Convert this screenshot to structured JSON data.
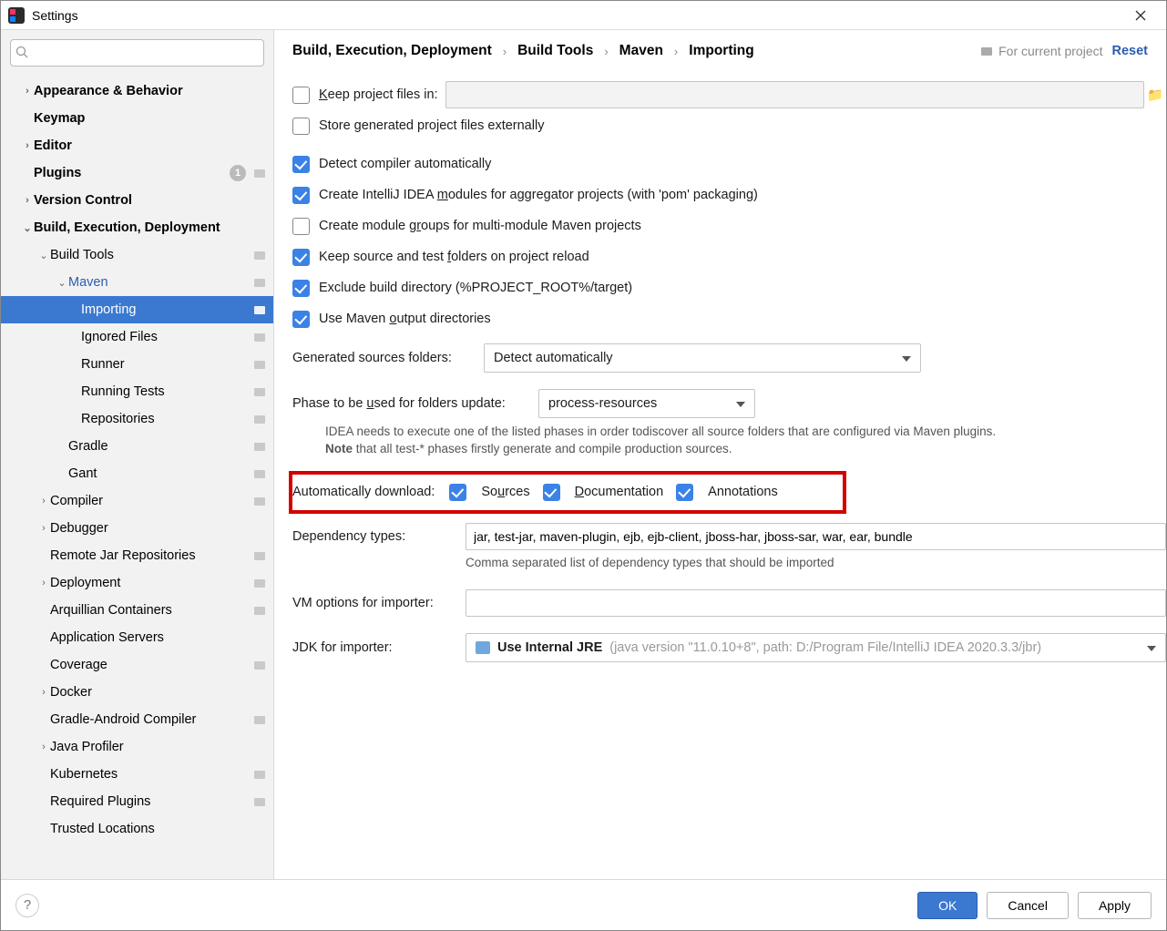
{
  "window": {
    "title": "Settings"
  },
  "search": {
    "placeholder": ""
  },
  "sidebar": {
    "items": [
      {
        "label": "Appearance & Behavior"
      },
      {
        "label": "Keymap"
      },
      {
        "label": "Editor"
      },
      {
        "label": "Plugins",
        "badge": "1"
      },
      {
        "label": "Version Control"
      },
      {
        "label": "Build, Execution, Deployment"
      },
      {
        "label": "Build Tools"
      },
      {
        "label": "Maven"
      },
      {
        "label": "Importing"
      },
      {
        "label": "Ignored Files"
      },
      {
        "label": "Runner"
      },
      {
        "label": "Running Tests"
      },
      {
        "label": "Repositories"
      },
      {
        "label": "Gradle"
      },
      {
        "label": "Gant"
      },
      {
        "label": "Compiler"
      },
      {
        "label": "Debugger"
      },
      {
        "label": "Remote Jar Repositories"
      },
      {
        "label": "Deployment"
      },
      {
        "label": "Arquillian Containers"
      },
      {
        "label": "Application Servers"
      },
      {
        "label": "Coverage"
      },
      {
        "label": "Docker"
      },
      {
        "label": "Gradle-Android Compiler"
      },
      {
        "label": "Java Profiler"
      },
      {
        "label": "Kubernetes"
      },
      {
        "label": "Required Plugins"
      },
      {
        "label": "Trusted Locations"
      }
    ]
  },
  "breadcrumbs": {
    "a": "Build, Execution, Deployment",
    "b": "Build Tools",
    "c": "Maven",
    "d": "Importing"
  },
  "header": {
    "for_project": "For current project",
    "reset": "Reset"
  },
  "form": {
    "keep_project_files_label": "eep project files in:",
    "keep_project_files_prefix": "K",
    "store_external": "Store generated project files externally",
    "detect_compiler": "Detect compiler automatically",
    "create_modules_pre": "Create IntelliJ IDEA ",
    "create_modules_u": "m",
    "create_modules_post": "odules for aggregator projects (with 'pom' packaging)",
    "create_groups_pre": "Create module g",
    "create_groups_u": "r",
    "create_groups_post": "oups for multi-module Maven projects",
    "keep_source_pre": "Keep source and test ",
    "keep_source_u": "f",
    "keep_source_post": "olders on project reload",
    "exclude_build": "Exclude build directory (%PROJECT_ROOT%/target)",
    "use_output_pre": "Use Maven ",
    "use_output_u": "o",
    "use_output_post": "utput directories",
    "gen_sources_label": "Generated sources folders:",
    "gen_sources_value": "Detect automatically",
    "phase_label_pre": "Phase to be ",
    "phase_label_u": "u",
    "phase_label_post": "sed for folders update:",
    "phase_value": "process-resources",
    "phase_help1": "IDEA needs to execute one of the listed phases in order todiscover all source folders that are configured via Maven plugins.",
    "phase_help2_b": "Note",
    "phase_help2": " that all test-* phases firstly generate and compile production sources.",
    "auto_download_label": "Automatically download:",
    "sources_pre": "So",
    "sources_u": "u",
    "sources_post": "rces",
    "docs_u": "D",
    "docs_post": "ocumentation",
    "annotations": "Annotations",
    "dep_types_label": "Dependency types:",
    "dep_types_value": "jar, test-jar, maven-plugin, ejb, ejb-client, jboss-har, jboss-sar, war, ear, bundle",
    "dep_types_help": "Comma separated list of dependency types that should be imported",
    "vm_label": "VM options for importer:",
    "vm_value": "",
    "jdk_label": "JDK for importer:",
    "jdk_value_bold": "Use Internal JRE",
    "jdk_value_dim": "(java version \"11.0.10+8\", path: D:/Program File/IntelliJ IDEA 2020.3.3/jbr)"
  },
  "footer": {
    "ok": "OK",
    "cancel": "Cancel",
    "apply": "Apply"
  }
}
